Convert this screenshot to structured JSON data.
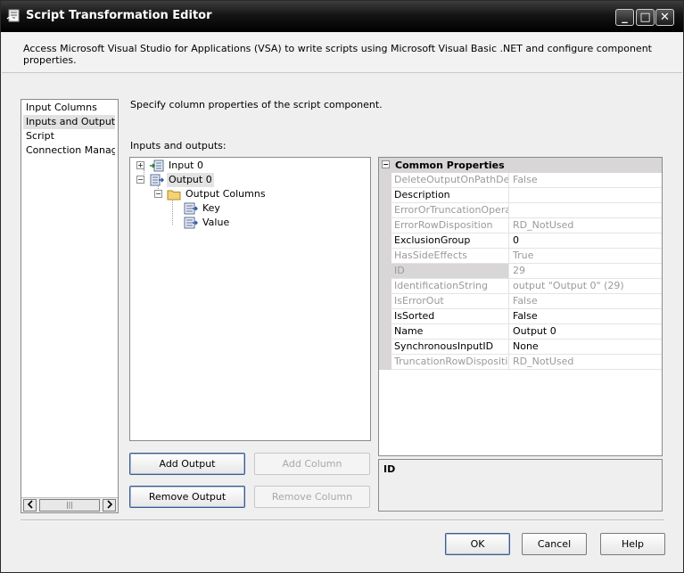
{
  "window": {
    "title": "Script Transformation Editor",
    "controls": {
      "minimize": "_",
      "maximize": "□",
      "close": "✕"
    }
  },
  "header": {
    "description": "Access Microsoft Visual Studio for Applications (VSA) to write scripts using Microsoft Visual Basic .NET and configure component properties."
  },
  "nav": {
    "items": [
      {
        "label": "Input Columns",
        "selected": false
      },
      {
        "label": "Inputs and Outputs",
        "selected": true
      },
      {
        "label": "Script",
        "selected": false
      },
      {
        "label": "Connection Managers",
        "selected": false
      }
    ]
  },
  "main": {
    "section_description": "Specify column properties of the script component.",
    "io_label": "Inputs and outputs:"
  },
  "tree": {
    "nodes": [
      {
        "label": "Input 0",
        "icon": "input-icon",
        "expanded": false
      },
      {
        "label": "Output 0",
        "icon": "output-icon",
        "expanded": true,
        "selected": true
      },
      {
        "label": "Output Columns",
        "icon": "folder-icon",
        "expanded": true
      },
      {
        "label": "Key",
        "icon": "column-icon"
      },
      {
        "label": "Value",
        "icon": "column-icon"
      }
    ]
  },
  "buttons": {
    "add_output": "Add Output",
    "add_column": "Add Column",
    "remove_output": "Remove Output",
    "remove_column": "Remove Column",
    "ok": "OK",
    "cancel": "Cancel",
    "help": "Help"
  },
  "properties": {
    "category": "Common Properties",
    "rows": [
      {
        "name": "DeleteOutputOnPathDetached",
        "value": "False",
        "readonly": true
      },
      {
        "name": "Description",
        "value": "",
        "readonly": false
      },
      {
        "name": "ErrorOrTruncationOperation",
        "value": "",
        "readonly": true
      },
      {
        "name": "ErrorRowDisposition",
        "value": "RD_NotUsed",
        "readonly": true
      },
      {
        "name": "ExclusionGroup",
        "value": "0",
        "readonly": false
      },
      {
        "name": "HasSideEffects",
        "value": "True",
        "readonly": true
      },
      {
        "name": "ID",
        "value": "29",
        "readonly": true,
        "selected": true
      },
      {
        "name": "IdentificationString",
        "value": "output \"Output 0\" (29)",
        "readonly": true
      },
      {
        "name": "IsErrorOut",
        "value": "False",
        "readonly": true
      },
      {
        "name": "IsSorted",
        "value": "False",
        "readonly": false
      },
      {
        "name": "Name",
        "value": "Output 0",
        "readonly": false
      },
      {
        "name": "SynchronousInputID",
        "value": "None",
        "readonly": false
      },
      {
        "name": "TruncationRowDisposition",
        "value": "RD_NotUsed",
        "readonly": true
      }
    ],
    "description_title": "ID"
  },
  "scrollbar": {
    "thumb_glyph": "|||"
  }
}
